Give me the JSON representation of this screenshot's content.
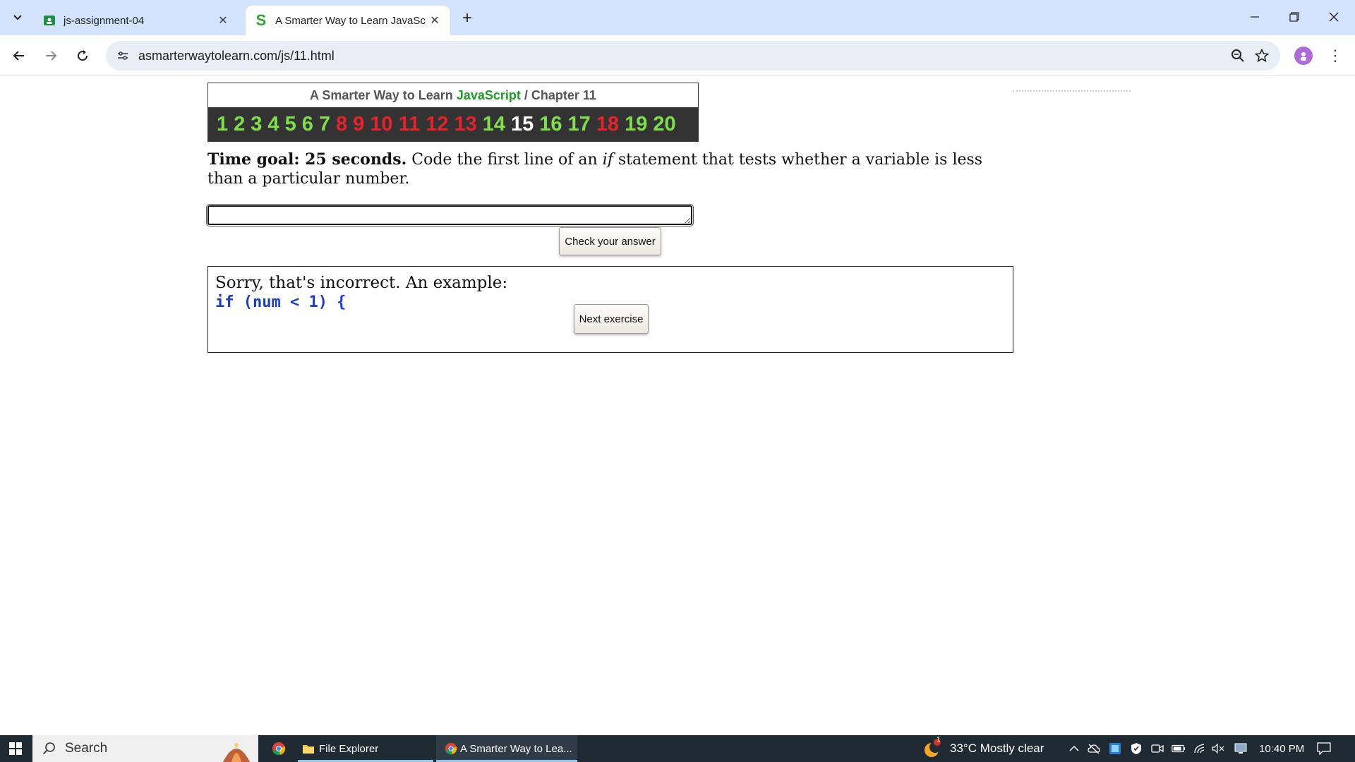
{
  "browser": {
    "tabs": [
      {
        "title": "js-assignment-04",
        "active": false,
        "favicon": "classroom-icon"
      },
      {
        "title": "A Smarter Way to Learn JavaScr",
        "active": true,
        "favicon": "site-s-icon",
        "favicon_text": "S"
      }
    ],
    "new_tab_label": "+",
    "url": "asmarterwaytolearn.com/js/11.html"
  },
  "page": {
    "header": {
      "prefix": "A Smarter Way to Learn",
      "js": "JavaScript",
      "separator": "/",
      "chapter": "Chapter 11"
    },
    "chapter_numbers": [
      {
        "n": "1",
        "color": "#7fe04a"
      },
      {
        "n": "2",
        "color": "#7fe04a"
      },
      {
        "n": "3",
        "color": "#7fe04a"
      },
      {
        "n": "4",
        "color": "#7fe04a"
      },
      {
        "n": "5",
        "color": "#7fe04a"
      },
      {
        "n": "6",
        "color": "#7fe04a"
      },
      {
        "n": "7",
        "color": "#7fe04a"
      },
      {
        "n": "8",
        "color": "#e8222a"
      },
      {
        "n": "9",
        "color": "#e8222a"
      },
      {
        "n": "10",
        "color": "#e8222a"
      },
      {
        "n": "11",
        "color": "#e8222a"
      },
      {
        "n": "12",
        "color": "#e8222a"
      },
      {
        "n": "13",
        "color": "#e8222a"
      },
      {
        "n": "14",
        "color": "#7fe04a"
      },
      {
        "n": "15",
        "color": "#ffffff"
      },
      {
        "n": "16",
        "color": "#7fe04a"
      },
      {
        "n": "17",
        "color": "#7fe04a"
      },
      {
        "n": "18",
        "color": "#e8222a"
      },
      {
        "n": "19",
        "color": "#7fe04a"
      },
      {
        "n": "20",
        "color": "#7fe04a"
      }
    ],
    "question": {
      "goal": "Time goal: 25 seconds.",
      "text_before": "Code the first line of an",
      "keyword": "if",
      "text_after": "statement that tests whether a variable is less than a particular number."
    },
    "answer_value": "",
    "check_button": "Check your answer",
    "feedback": {
      "message": "Sorry, that's incorrect. An example:",
      "code": "if (num < 1) {",
      "next_button": "Next exercise"
    }
  },
  "taskbar": {
    "search_label": "Search",
    "items": [
      {
        "label": "",
        "icon": "chrome-icon"
      },
      {
        "label": "File Explorer",
        "icon": "folder-icon"
      },
      {
        "label": "A Smarter Way to Lea...",
        "icon": "chrome-icon"
      }
    ],
    "weather": "33°C  Mostly clear",
    "weather_badge": "1",
    "time": "10:40 PM"
  }
}
